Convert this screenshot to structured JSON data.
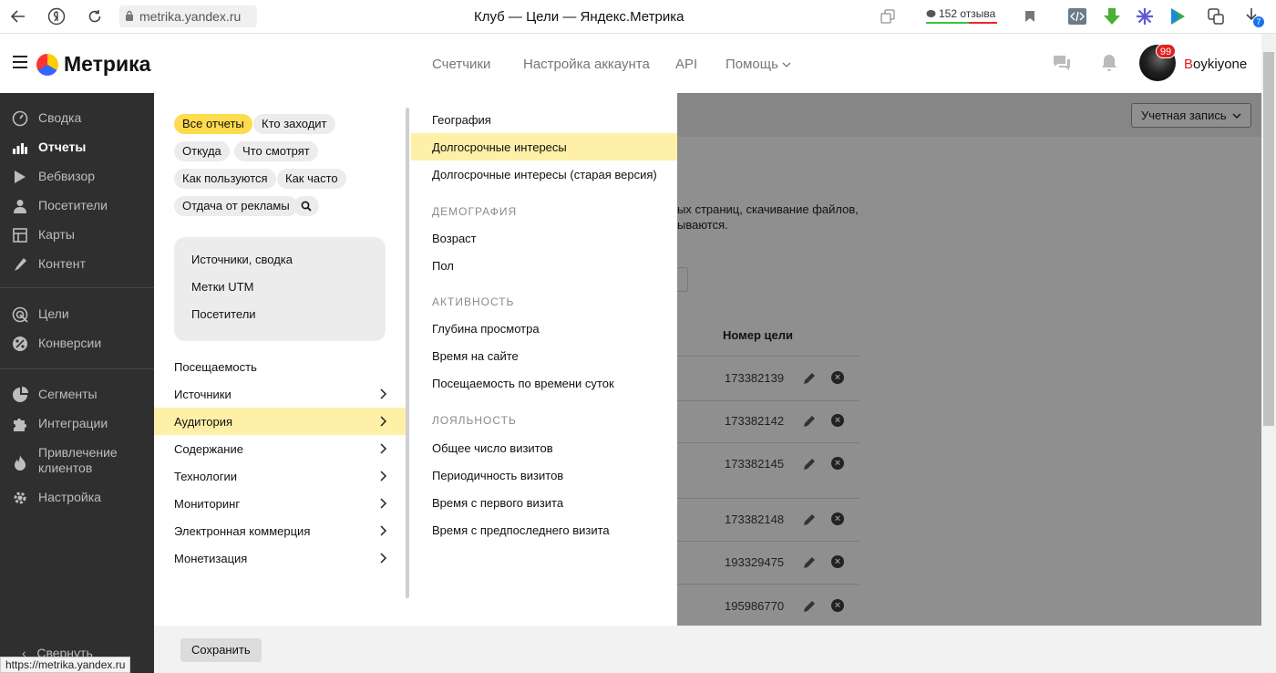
{
  "browser": {
    "url": "metrika.yandex.ru",
    "title": "Клуб — Цели — Яндекс.Метрика",
    "reviews": "152 отзыва",
    "download_badge": "7"
  },
  "header": {
    "logo": "Метрика",
    "nav": [
      "Счетчики",
      "Настройка аккаунта",
      "API",
      "Помощь"
    ],
    "notifications_badge": "99",
    "username_first": "B",
    "username_rest": "oykiyone"
  },
  "sidebar": {
    "items": [
      {
        "label": "Сводка",
        "icon": "gauge-icon"
      },
      {
        "label": "Отчеты",
        "icon": "bar-chart-icon"
      },
      {
        "label": "Вебвизор",
        "icon": "play-icon"
      },
      {
        "label": "Посетители",
        "icon": "person-icon"
      },
      {
        "label": "Карты",
        "icon": "map-icon"
      },
      {
        "label": "Контент",
        "icon": "pencil-icon"
      },
      {
        "label": "Цели",
        "icon": "target-icon"
      },
      {
        "label": "Конверсии",
        "icon": "percent-icon"
      },
      {
        "label": "Сегменты",
        "icon": "pie-icon"
      },
      {
        "label": "Интеграции",
        "icon": "puzzle-icon"
      },
      {
        "label": "Привлечение клиентов",
        "icon": "fire-icon"
      },
      {
        "label": "Настройка",
        "icon": "gear-icon"
      }
    ],
    "collapse": "Свернуть"
  },
  "reports": {
    "chips": [
      "Все отчеты",
      "Кто заходит",
      "Откуда",
      "Что смотрят",
      "Как пользуются",
      "Как часто",
      "Отдача от рекламы"
    ],
    "quick": [
      "Источники, сводка",
      "Метки UTM",
      "Посетители"
    ],
    "menu": [
      {
        "label": "Посещаемость",
        "arrow": false
      },
      {
        "label": "Источники",
        "arrow": true
      },
      {
        "label": "Аудитория",
        "arrow": true
      },
      {
        "label": "Содержание",
        "arrow": true
      },
      {
        "label": "Технологии",
        "arrow": true
      },
      {
        "label": "Мониторинг",
        "arrow": true
      },
      {
        "label": "Электронная коммерция",
        "arrow": true
      },
      {
        "label": "Монетизация",
        "arrow": true
      }
    ]
  },
  "audience": {
    "top": [
      "География",
      "Долгосрочные интересы",
      "Долгосрочные интересы (старая версия)"
    ],
    "demography_head": "ДЕМОГРАФИЯ",
    "demography": [
      "Возраст",
      "Пол"
    ],
    "activity_head": "АКТИВНОСТЬ",
    "activity": [
      "Глубина просмотра",
      "Время на сайте",
      "Посещаемость по времени суток"
    ],
    "loyalty_head": "ЛОЯЛЬНОСТЬ",
    "loyalty": [
      "Общее число визитов",
      "Периодичность визитов",
      "Время с первого визита",
      "Время с предпоследнего визита"
    ]
  },
  "content": {
    "account_button": "Учетная запись",
    "desc_line1": "ых страниц, скачивание файлов,",
    "desc_line2": "ываются.",
    "goal_column": "Номер цели",
    "goals": [
      "173382139",
      "173382142",
      "173382145",
      "173382148",
      "193329475",
      "195986770"
    ]
  },
  "footer": {
    "save": "Сохранить",
    "status_url": "https://metrika.yandex.ru"
  }
}
